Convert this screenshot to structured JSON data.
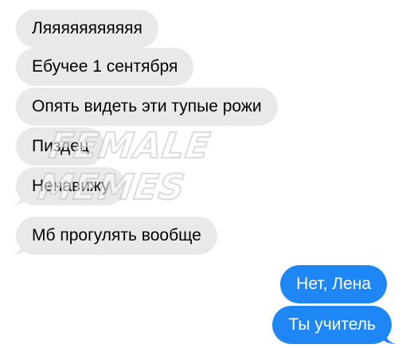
{
  "messages": [
    {
      "text": "Ляяяяяяяяяяя",
      "side": "incoming"
    },
    {
      "text": "Ебучее 1 сентября",
      "side": "incoming"
    },
    {
      "text": "Опять видеть эти тупые рожи",
      "side": "incoming"
    },
    {
      "text": "Пиздец",
      "side": "incoming"
    },
    {
      "text": "Ненавижу",
      "side": "incoming"
    },
    {
      "text": "Мб прогулять вообще",
      "side": "incoming"
    },
    {
      "text": "Нет, Лена",
      "side": "outgoing"
    },
    {
      "text": "Ты учитель",
      "side": "outgoing"
    }
  ],
  "watermark": {
    "line1": "FEMALE",
    "line2": "MEMES"
  },
  "colors": {
    "incoming_bubble": "#e9e9eb",
    "outgoing_bubble": "#1f87f5",
    "outgoing_text": "#ffffff"
  }
}
